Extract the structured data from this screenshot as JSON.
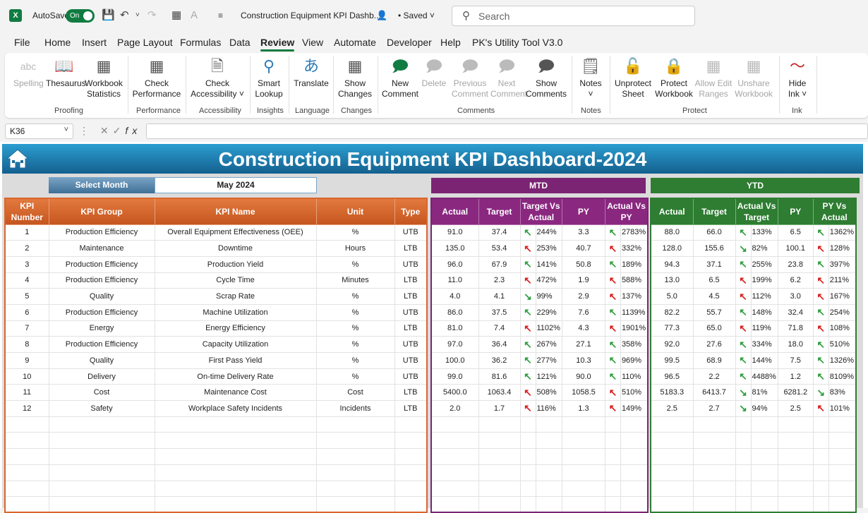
{
  "titlebar": {
    "autosave_label": "AutoSave",
    "autosave_state": "On",
    "doc_title": "Construction Equipment KPI Dashb...",
    "saved_status": "Saved",
    "search_placeholder": "Search"
  },
  "menu": [
    "File",
    "Home",
    "Insert",
    "Page Layout",
    "Formulas",
    "Data",
    "Review",
    "View",
    "Automate",
    "Developer",
    "Help",
    "PK's Utility Tool V3.0"
  ],
  "menu_active": "Review",
  "ribbon": {
    "buttons": [
      {
        "label": "Spelling",
        "icon": "abc-check-icon",
        "disabled": true
      },
      {
        "label": "Thesaurus",
        "icon": "book-icon",
        "disabled": false
      },
      {
        "label": "Workbook\nStatistics",
        "icon": "grid-stats-icon",
        "disabled": false
      },
      {
        "label": "Check\nPerformance",
        "icon": "performance-icon",
        "disabled": false
      },
      {
        "label": "Check\nAccessibility ˅",
        "icon": "accessibility-icon",
        "disabled": false
      },
      {
        "label": "Smart\nLookup",
        "icon": "smart-lookup-icon",
        "disabled": false
      },
      {
        "label": "Translate",
        "icon": "translate-icon",
        "disabled": false
      },
      {
        "label": "Show\nChanges",
        "icon": "show-changes-icon",
        "disabled": false
      },
      {
        "label": "New\nComment",
        "icon": "new-comment-icon",
        "disabled": false
      },
      {
        "label": "Delete",
        "icon": "delete-comment-icon",
        "disabled": true
      },
      {
        "label": "Previous\nComment",
        "icon": "previous-comment-icon",
        "disabled": true
      },
      {
        "label": "Next\nComment",
        "icon": "next-comment-icon",
        "disabled": true
      },
      {
        "label": "Show\nComments",
        "icon": "show-comments-icon",
        "disabled": false
      },
      {
        "label": "Notes\n˅",
        "icon": "notes-icon",
        "disabled": false
      },
      {
        "label": "Unprotect\nSheet",
        "icon": "unprotect-sheet-icon",
        "disabled": false
      },
      {
        "label": "Protect\nWorkbook",
        "icon": "protect-workbook-icon",
        "disabled": false
      },
      {
        "label": "Allow Edit\nRanges",
        "icon": "allow-edit-ranges-icon",
        "disabled": true
      },
      {
        "label": "Unshare\nWorkbook",
        "icon": "unshare-workbook-icon",
        "disabled": true
      },
      {
        "label": "Hide\nInk ˅",
        "icon": "ink-icon",
        "disabled": false
      }
    ],
    "groups": [
      "Proofing",
      "Performance",
      "Accessibility",
      "Insights",
      "Language",
      "Changes",
      "Comments",
      "Notes",
      "Protect",
      "Ink"
    ]
  },
  "formula_bar": {
    "name_box": "K36",
    "formula": ""
  },
  "dashboard": {
    "title": "Construction Equipment KPI Dashboard-2024",
    "select_month_label": "Select Month",
    "select_month_value": "May 2024",
    "mtd_label": "MTD",
    "ytd_label": "YTD",
    "main_headers": [
      "KPI Number",
      "KPI Group",
      "KPI Name",
      "Unit",
      "Type"
    ],
    "mtd_headers": [
      "Actual",
      "Target",
      "Target Vs Actual",
      "PY",
      "Actual Vs PY"
    ],
    "ytd_headers": [
      "Actual",
      "Target",
      "Actual Vs Target",
      "PY",
      "PY Vs Actual"
    ],
    "colors": {
      "green_arrow": "#2e9e3e",
      "red_arrow": "#d6201f",
      "kpi_header": "#d9662b",
      "mtd_header": "#8a2880",
      "ytd_header": "#2e7d32",
      "banner": "#1f7fb3"
    },
    "rows": [
      {
        "num": "1",
        "group": "Production Efficiency",
        "name": "Overall Equipment Effectiveness (OEE)",
        "unit": "%",
        "type": "UTB",
        "mtd": {
          "actual": "91.0",
          "target": "37.4",
          "tva_dir": "up",
          "tva": "244%",
          "py": "3.3",
          "avp_dir": "up",
          "avp": "2783%"
        },
        "ytd": {
          "actual": "88.0",
          "target": "66.0",
          "avt_dir": "up",
          "avt": "133%",
          "py": "6.5",
          "pva_dir": "up",
          "pva": "1362%"
        }
      },
      {
        "num": "2",
        "group": "Maintenance",
        "name": "Downtime",
        "unit": "Hours",
        "type": "LTB",
        "mtd": {
          "actual": "135.0",
          "target": "53.4",
          "tva_dir": "up-red",
          "tva": "253%",
          "py": "40.7",
          "avp_dir": "up-red",
          "avp": "332%"
        },
        "ytd": {
          "actual": "128.0",
          "target": "155.6",
          "avt_dir": "down",
          "avt": "82%",
          "py": "100.1",
          "pva_dir": "up-red",
          "pva": "128%"
        }
      },
      {
        "num": "3",
        "group": "Production Efficiency",
        "name": "Production Yield",
        "unit": "%",
        "type": "UTB",
        "mtd": {
          "actual": "96.0",
          "target": "67.9",
          "tva_dir": "up",
          "tva": "141%",
          "py": "50.8",
          "avp_dir": "up",
          "avp": "189%"
        },
        "ytd": {
          "actual": "94.3",
          "target": "37.1",
          "avt_dir": "up",
          "avt": "255%",
          "py": "23.8",
          "pva_dir": "up",
          "pva": "397%"
        }
      },
      {
        "num": "4",
        "group": "Production Efficiency",
        "name": "Cycle Time",
        "unit": "Minutes",
        "type": "LTB",
        "mtd": {
          "actual": "11.0",
          "target": "2.3",
          "tva_dir": "up-red",
          "tva": "472%",
          "py": "1.9",
          "avp_dir": "up-red",
          "avp": "588%"
        },
        "ytd": {
          "actual": "13.0",
          "target": "6.5",
          "avt_dir": "up-red",
          "avt": "199%",
          "py": "6.2",
          "pva_dir": "up-red",
          "pva": "211%"
        }
      },
      {
        "num": "5",
        "group": "Quality",
        "name": "Scrap Rate",
        "unit": "%",
        "type": "LTB",
        "mtd": {
          "actual": "4.0",
          "target": "4.1",
          "tva_dir": "down",
          "tva": "99%",
          "py": "2.9",
          "avp_dir": "up-red",
          "avp": "137%"
        },
        "ytd": {
          "actual": "5.0",
          "target": "4.5",
          "avt_dir": "up-red",
          "avt": "112%",
          "py": "3.0",
          "pva_dir": "up-red",
          "pva": "167%"
        }
      },
      {
        "num": "6",
        "group": "Production Efficiency",
        "name": "Machine Utilization",
        "unit": "%",
        "type": "UTB",
        "mtd": {
          "actual": "86.0",
          "target": "37.5",
          "tva_dir": "up",
          "tva": "229%",
          "py": "7.6",
          "avp_dir": "up",
          "avp": "1139%"
        },
        "ytd": {
          "actual": "82.2",
          "target": "55.7",
          "avt_dir": "up",
          "avt": "148%",
          "py": "32.4",
          "pva_dir": "up",
          "pva": "254%"
        }
      },
      {
        "num": "7",
        "group": "Energy",
        "name": "Energy Efficiency",
        "unit": "%",
        "type": "LTB",
        "mtd": {
          "actual": "81.0",
          "target": "7.4",
          "tva_dir": "up-red",
          "tva": "1102%",
          "py": "4.3",
          "avp_dir": "up-red",
          "avp": "1901%"
        },
        "ytd": {
          "actual": "77.3",
          "target": "65.0",
          "avt_dir": "up-red",
          "avt": "119%",
          "py": "71.8",
          "pva_dir": "up-red",
          "pva": "108%"
        }
      },
      {
        "num": "8",
        "group": "Production Efficiency",
        "name": "Capacity Utilization",
        "unit": "%",
        "type": "UTB",
        "mtd": {
          "actual": "97.0",
          "target": "36.4",
          "tva_dir": "up",
          "tva": "267%",
          "py": "27.1",
          "avp_dir": "up",
          "avp": "358%"
        },
        "ytd": {
          "actual": "92.0",
          "target": "27.6",
          "avt_dir": "up",
          "avt": "334%",
          "py": "18.0",
          "pva_dir": "up",
          "pva": "510%"
        }
      },
      {
        "num": "9",
        "group": "Quality",
        "name": "First Pass Yield",
        "unit": "%",
        "type": "UTB",
        "mtd": {
          "actual": "100.0",
          "target": "36.2",
          "tva_dir": "up",
          "tva": "277%",
          "py": "10.3",
          "avp_dir": "up",
          "avp": "969%"
        },
        "ytd": {
          "actual": "99.5",
          "target": "68.9",
          "avt_dir": "up",
          "avt": "144%",
          "py": "7.5",
          "pva_dir": "up",
          "pva": "1326%"
        }
      },
      {
        "num": "10",
        "group": "Delivery",
        "name": "On-time Delivery Rate",
        "unit": "%",
        "type": "UTB",
        "mtd": {
          "actual": "99.0",
          "target": "81.6",
          "tva_dir": "up",
          "tva": "121%",
          "py": "90.0",
          "avp_dir": "up",
          "avp": "110%"
        },
        "ytd": {
          "actual": "96.5",
          "target": "2.2",
          "avt_dir": "up",
          "avt": "4488%",
          "py": "1.2",
          "pva_dir": "up",
          "pva": "8109%"
        }
      },
      {
        "num": "11",
        "group": "Cost",
        "name": "Maintenance Cost",
        "unit": "Cost",
        "type": "LTB",
        "mtd": {
          "actual": "5400.0",
          "target": "1063.4",
          "tva_dir": "up-red",
          "tva": "508%",
          "py": "1058.5",
          "avp_dir": "up-red",
          "avp": "510%"
        },
        "ytd": {
          "actual": "5183.3",
          "target": "6413.7",
          "avt_dir": "down",
          "avt": "81%",
          "py": "6281.2",
          "pva_dir": "down",
          "pva": "83%"
        }
      },
      {
        "num": "12",
        "group": "Safety",
        "name": "Workplace Safety Incidents",
        "unit": "Incidents",
        "type": "LTB",
        "mtd": {
          "actual": "2.0",
          "target": "1.7",
          "tva_dir": "up-red",
          "tva": "116%",
          "py": "1.3",
          "avp_dir": "up-red",
          "avp": "149%"
        },
        "ytd": {
          "actual": "2.5",
          "target": "2.7",
          "avt_dir": "down",
          "avt": "94%",
          "py": "2.5",
          "pva_dir": "up-red",
          "pva": "101%"
        }
      }
    ]
  }
}
